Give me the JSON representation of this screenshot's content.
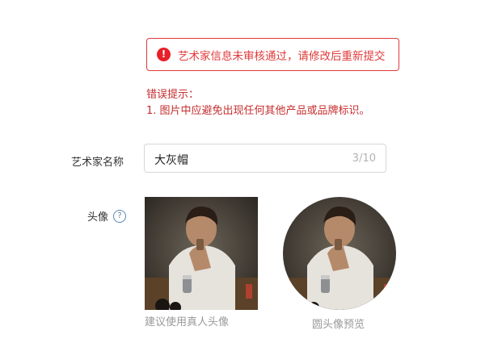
{
  "alert": {
    "icon": "exclamation-circle-icon",
    "icon_glyph": "!",
    "message": "艺术家信息未审核通过，请修改后重新提交",
    "color": "#e03a3a"
  },
  "error": {
    "title": "错误提示：",
    "items": [
      "1. 图片中应避免出现任何其他产品或品牌标识。"
    ],
    "color": "#c62d2d"
  },
  "form": {
    "name_label": "艺术家名称",
    "name_value": "大灰帽",
    "name_count": "3/10",
    "avatar_label": "头像",
    "help_icon": "question-circle-icon",
    "help_glyph": "?"
  },
  "avatar": {
    "square_hint": "建议使用真人头像",
    "circle_hint": "圆头像预览"
  }
}
